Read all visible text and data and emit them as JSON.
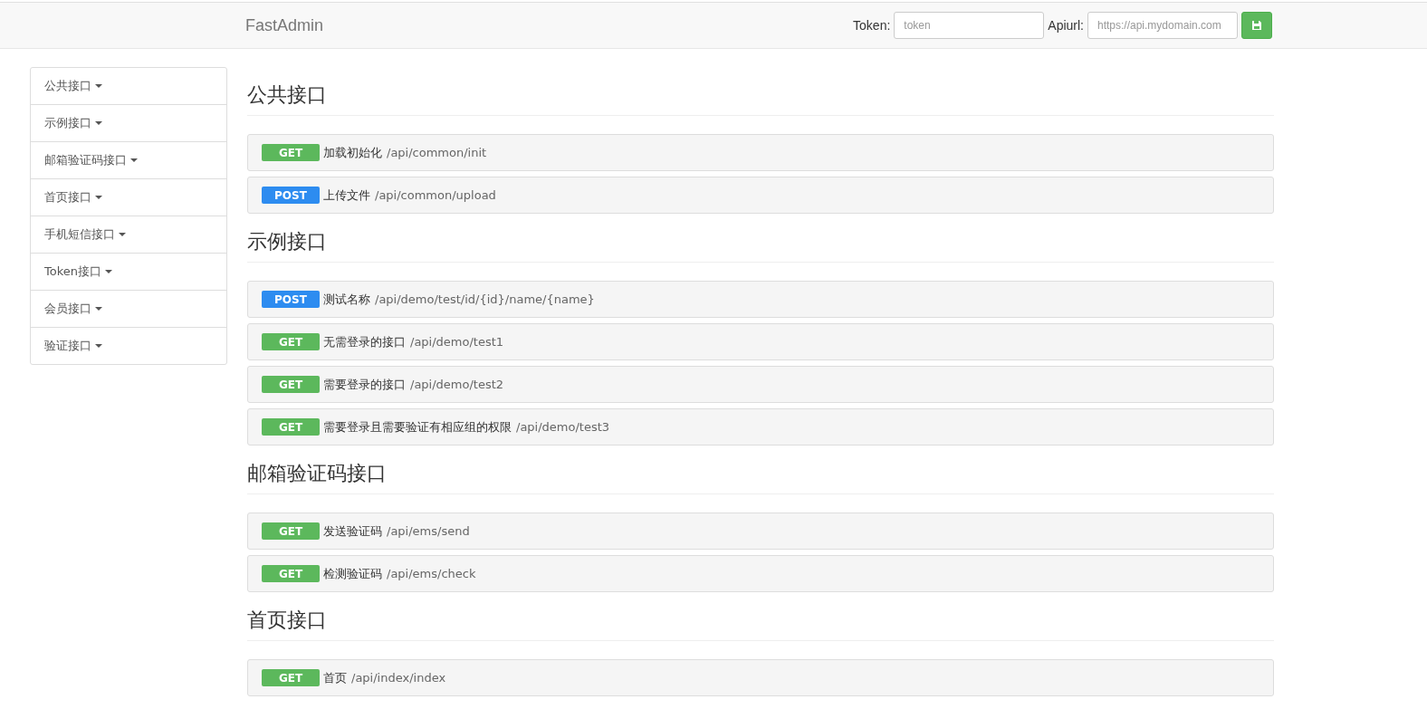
{
  "header": {
    "brand": "FastAdmin",
    "token_label": "Token:",
    "token_placeholder": "token",
    "apiurl_label": "Apiurl:",
    "apiurl_placeholder": "https://api.mydomain.com"
  },
  "sidebar": {
    "items": [
      {
        "label": "公共接口"
      },
      {
        "label": "示例接口"
      },
      {
        "label": "邮箱验证码接口"
      },
      {
        "label": "首页接口"
      },
      {
        "label": "手机短信接口"
      },
      {
        "label": "Token接口"
      },
      {
        "label": "会员接口"
      },
      {
        "label": "验证接口"
      }
    ]
  },
  "sections": [
    {
      "title": "公共接口",
      "apis": [
        {
          "method": "GET",
          "kind": "get",
          "name": "加载初始化",
          "path": "/api/common/init"
        },
        {
          "method": "POST",
          "kind": "post",
          "name": "上传文件",
          "path": "/api/common/upload"
        }
      ]
    },
    {
      "title": "示例接口",
      "apis": [
        {
          "method": "POST",
          "kind": "post",
          "name": "测试名称",
          "path": "/api/demo/test/id/{id}/name/{name}"
        },
        {
          "method": "GET",
          "kind": "get",
          "name": "无需登录的接口",
          "path": "/api/demo/test1"
        },
        {
          "method": "GET",
          "kind": "get",
          "name": "需要登录的接口",
          "path": "/api/demo/test2"
        },
        {
          "method": "GET",
          "kind": "get",
          "name": "需要登录且需要验证有相应组的权限",
          "path": "/api/demo/test3"
        }
      ]
    },
    {
      "title": "邮箱验证码接口",
      "apis": [
        {
          "method": "GET",
          "kind": "get",
          "name": "发送验证码",
          "path": "/api/ems/send"
        },
        {
          "method": "GET",
          "kind": "get",
          "name": "检测验证码",
          "path": "/api/ems/check"
        }
      ]
    },
    {
      "title": "首页接口",
      "apis": [
        {
          "method": "GET",
          "kind": "get",
          "name": "首页",
          "path": "/api/index/index"
        }
      ]
    }
  ]
}
